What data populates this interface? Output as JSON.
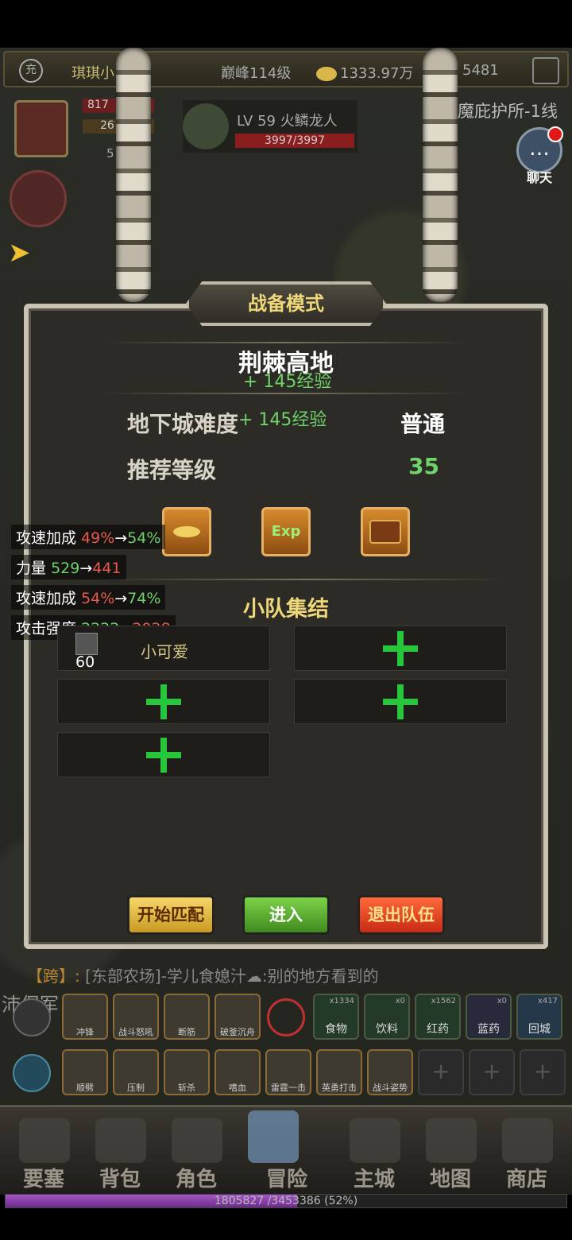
{
  "top_bar": {
    "vip_label": "充",
    "player_name": "琪琪小",
    "peak_level": "巅峰114级",
    "gold": "1333.97万",
    "gems": "5481"
  },
  "player": {
    "stat1": "817",
    "stat2": "26",
    "stat3": "5"
  },
  "target": {
    "name": "LV 59 火鳞龙人",
    "hp": "3997/3997"
  },
  "location": "魔庇护所-1线",
  "chat_label": "聊天",
  "dialog": {
    "title": "战备模式",
    "dungeon_name": "荆棘高地",
    "exp_float_1": "+ 145经验",
    "exp_float_2": "+ 145经验",
    "difficulty_label": "地下城难度",
    "difficulty_value": "普通",
    "recommended_label": "推荐等级",
    "recommended_value": "35",
    "rewards": [
      {
        "icon": "gold-coin-icon",
        "label": ""
      },
      {
        "icon": "exp-icon",
        "label": "Exp"
      },
      {
        "icon": "treasure-chest-icon",
        "label": ""
      }
    ],
    "squad_title": "小队集结",
    "member": {
      "name": "小可爱",
      "level": "60"
    },
    "buttons": {
      "match": "开始匹配",
      "enter": "进入",
      "leave": "退出队伍"
    }
  },
  "buffs": [
    {
      "name": "攻速加成",
      "from": "49%",
      "arrow": "→",
      "to": "54%"
    },
    {
      "name": "力量",
      "from": "529",
      "arrow": "→",
      "to": "441"
    },
    {
      "name": "攻速加成",
      "from": "54%",
      "arrow": "→",
      "to": "74%"
    },
    {
      "name": "攻击强度",
      "from": "2222",
      "arrow": "→",
      "to": "2028"
    }
  ],
  "bottom_chat": {
    "channel": "【跨】:",
    "message": "[东部农场]-学儿食媳汁☁:别的地方看到的",
    "prefix": "沛保军"
  },
  "skills_row1": [
    "冲锋",
    "战斗怒吼",
    "断筋",
    "破釜沉舟"
  ],
  "skills_row2": [
    "顺劈",
    "压制",
    "斩杀",
    "嗜血",
    "雷霆一击",
    "英勇打击",
    "战斗姿势"
  ],
  "items": [
    {
      "count": "x1334",
      "label": "食物"
    },
    {
      "count": "x0",
      "label": "饮料"
    },
    {
      "count": "x1562",
      "label": "红药"
    },
    {
      "count": "x0",
      "label": "蓝药"
    },
    {
      "count": "x417",
      "label": "回城"
    }
  ],
  "nav": [
    "要塞",
    "背包",
    "角色",
    "冒险",
    "主城",
    "地图",
    "商店"
  ],
  "xp": {
    "text": "1805827 /3453386 (52%)",
    "fraction": 0.52
  }
}
